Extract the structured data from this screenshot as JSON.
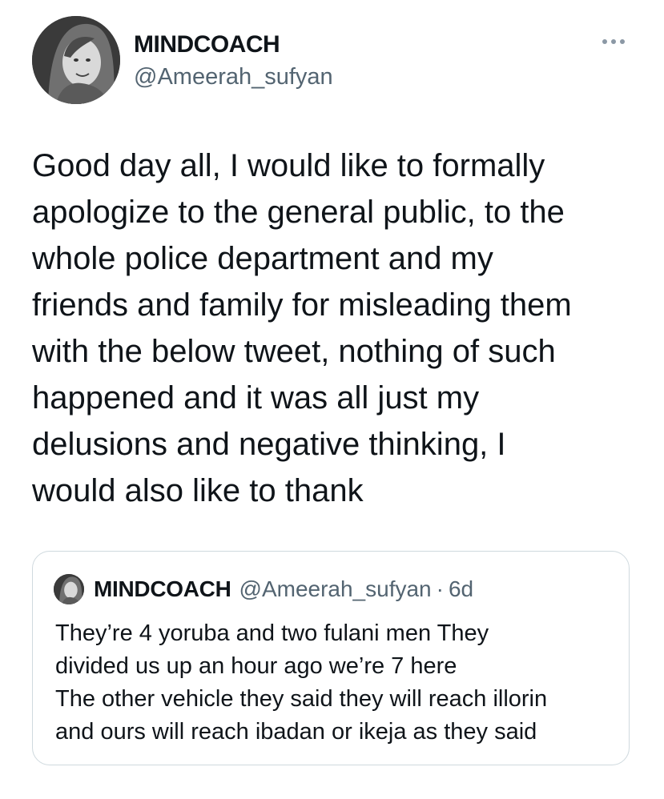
{
  "tweet": {
    "author": {
      "display_name": "MINDCOACH",
      "handle": "@Ameerah_sufyan",
      "avatar_icon": "profile-photo"
    },
    "more_icon": "more-horizontal-icon",
    "text_lines": [
      "Good day all, I would like to formally",
      "apologize to the general public, to the",
      "whole police department and my",
      "friends and family for misleading them",
      "with the below tweet, nothing of such",
      "happened and it was all just my",
      "delusions and negative thinking, I",
      "would also like to thank"
    ]
  },
  "quoted_tweet": {
    "display_name": "MINDCOACH",
    "handle": "@Ameerah_sufyan",
    "separator": "·",
    "time": "6d",
    "text_lines": [
      "They’re 4 yoruba and two fulani men They",
      "divided us up an hour ago we’re 7 here",
      "The other vehicle they said they will reach illorin",
      "and ours will reach ibadan or ikeja as they said"
    ]
  },
  "colors": {
    "text": "#0f1419",
    "secondary": "#536471",
    "border": "#cfd9de"
  }
}
